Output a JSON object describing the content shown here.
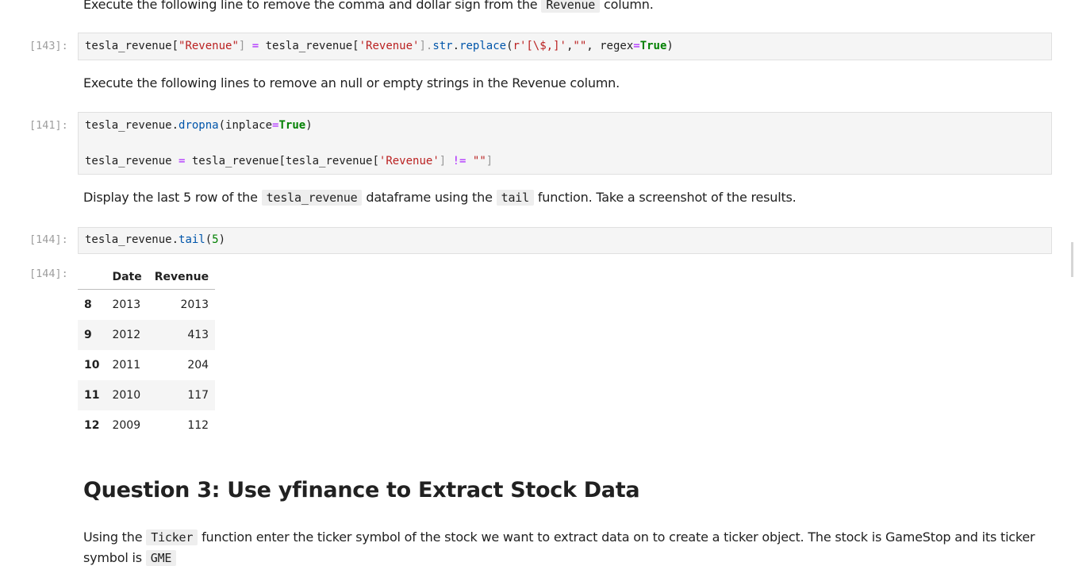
{
  "md_top": {
    "pre": "Execute the following line to remove the comma and dollar sign from the",
    "code": "Revenue",
    "post": "column."
  },
  "cell143": {
    "prompt": "[143]:",
    "tokens": [
      "tesla_revenue[",
      "\"Revenue\"",
      "] ",
      "=",
      " tesla_revenue[",
      "'Revenue'",
      "].",
      "str",
      ".",
      "replace",
      "(",
      "r'[\\$,]'",
      ",",
      "\"\"",
      ", regex",
      "=",
      "True",
      ")"
    ]
  },
  "md_null": {
    "text": "Execute the following lines to remove an null or empty strings in the Revenue column."
  },
  "cell141": {
    "prompt": "[141]:",
    "line1": [
      "tesla_revenue",
      ".",
      "dropna",
      "(inplace",
      "=",
      "True",
      ")"
    ],
    "line2": [
      "tesla_revenue ",
      "=",
      " tesla_revenue[tesla_revenue[",
      "'Revenue'",
      "] ",
      "!=",
      " ",
      "\"\"",
      "]"
    ]
  },
  "md_tail": {
    "pre": "Display the last 5 row of the",
    "code1": "tesla_revenue",
    "mid": "dataframe using the",
    "code2": "tail",
    "post": "function. Take a screenshot of the results."
  },
  "cell144": {
    "prompt": "[144]:",
    "tokens": [
      "tesla_revenue",
      ".",
      "tail",
      "(",
      "5",
      ")"
    ]
  },
  "out144": {
    "prompt": "[144]:",
    "columns": [
      "",
      "Date",
      "Revenue"
    ],
    "rows": [
      {
        "idx": "8",
        "date": "2013",
        "rev": "2013"
      },
      {
        "idx": "9",
        "date": "2012",
        "rev": "413"
      },
      {
        "idx": "10",
        "date": "2011",
        "rev": "204"
      },
      {
        "idx": "11",
        "date": "2010",
        "rev": "117"
      },
      {
        "idx": "12",
        "date": "2009",
        "rev": "112"
      }
    ]
  },
  "q3": {
    "title": "Question 3: Use yfinance to Extract Stock Data",
    "pre": "Using the",
    "code": "Ticker",
    "post": "function enter the ticker symbol of the stock we want to extract data on to create a ticker object. The stock is GameStop and its ticker",
    "cut": "symbol is",
    "cutcode": "GME"
  }
}
